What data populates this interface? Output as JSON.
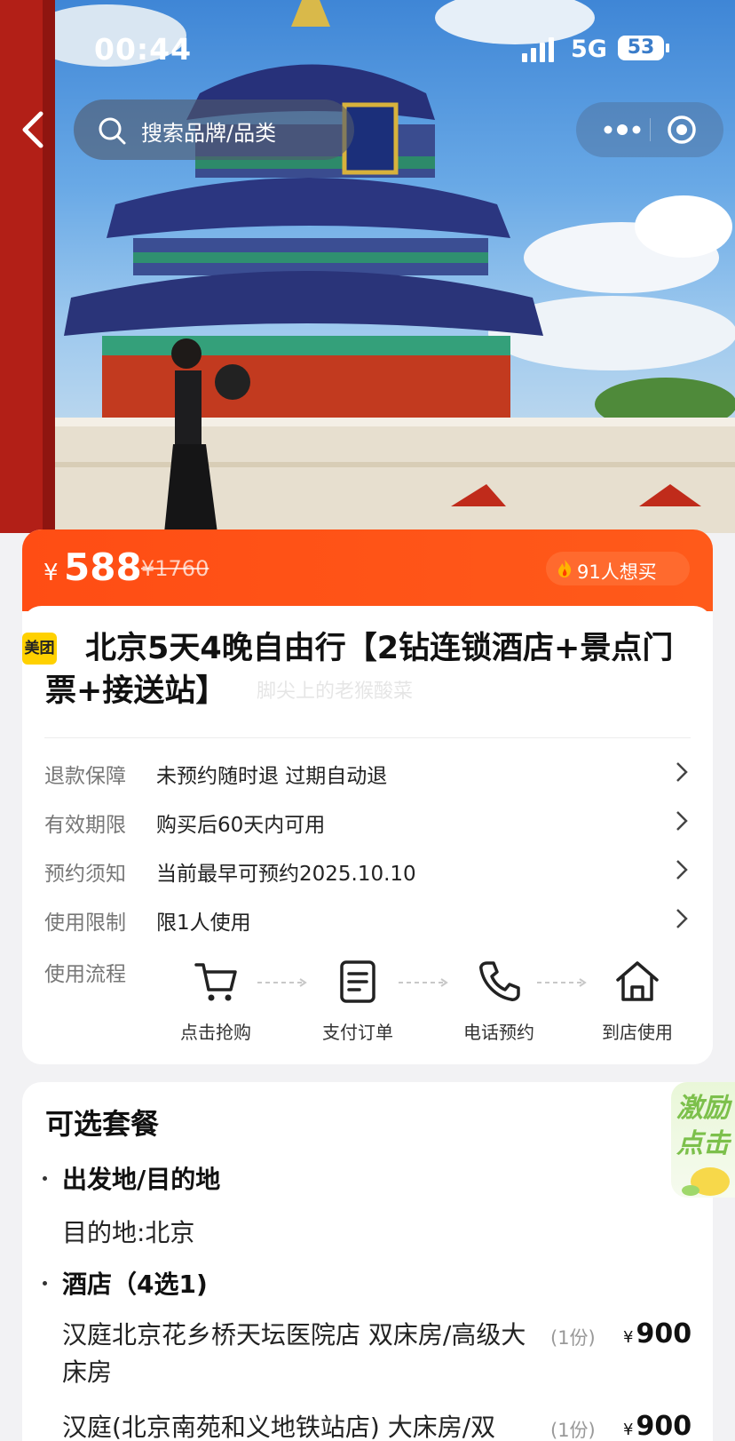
{
  "status_bar": {
    "time": "00:44",
    "network": "5G",
    "battery": "53"
  },
  "nav": {
    "search_placeholder": "搜索品牌/品类"
  },
  "price_bar": {
    "currency": "¥",
    "price": "588",
    "original_price": "¥1760",
    "want_count": "91人想买"
  },
  "product": {
    "brand_badge": "美团",
    "title": "北京5天4晚自由行【2钻连锁酒店+景点门票+接送站】",
    "watermark": "脚尖上的老猴酸菜"
  },
  "info_rows": [
    {
      "label": "退款保障",
      "value": "未预约随时退 过期自动退"
    },
    {
      "label": "有效期限",
      "value": "购买后60天内可用"
    },
    {
      "label": "预约须知",
      "value": "当前最早可预约2025.10.10"
    },
    {
      "label": "使用限制",
      "value": "限1人使用"
    }
  ],
  "process": {
    "label": "使用流程",
    "steps": [
      {
        "label": "点击抢购",
        "icon": "cart-icon"
      },
      {
        "label": "支付订单",
        "icon": "order-icon"
      },
      {
        "label": "电话预约",
        "icon": "phone-icon"
      },
      {
        "label": "到店使用",
        "icon": "home-icon"
      }
    ]
  },
  "packages": {
    "title": "可选套餐",
    "groups": [
      {
        "title": "出发地/目的地",
        "text": "目的地:北京"
      },
      {
        "title": "酒店（4选1)"
      }
    ],
    "options": [
      {
        "name": "汉庭北京花乡桥天坛医院店 双床房/高级大床房",
        "qty": "(1份)",
        "currency": "¥",
        "price": "900"
      },
      {
        "name": "汉庭(北京南苑和义地铁站店) 大床房/双",
        "qty": "(1份)",
        "currency": "¥",
        "price": "900"
      }
    ]
  },
  "promo": {
    "line1": "激励",
    "line2": "点击"
  },
  "colors": {
    "accent": "#ff4d14",
    "brand_yellow": "#ffd100"
  }
}
